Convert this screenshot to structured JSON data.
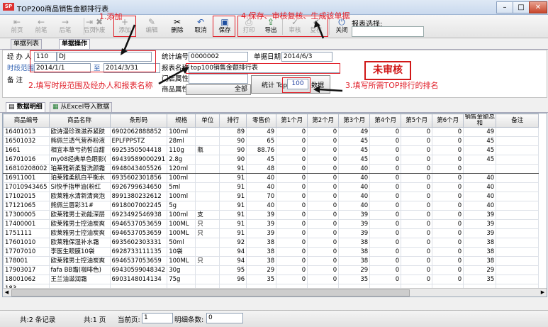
{
  "window": {
    "title": "TOP200商品销售金额排行表",
    "logo_text": "SP"
  },
  "toolbar": {
    "buttons": [
      {
        "label": "前页",
        "icon": "⇤"
      },
      {
        "label": "前笔",
        "icon": "←"
      },
      {
        "label": "后笔",
        "icon": "→"
      },
      {
        "label": "后页",
        "icon": "⇥"
      },
      {
        "label": "作废",
        "icon": "✖"
      },
      {
        "label": "添加",
        "icon": "+"
      },
      {
        "label": "编辑",
        "icon": "✎"
      },
      {
        "label": "删除",
        "icon": "✂"
      },
      {
        "label": "取消",
        "icon": "↶"
      },
      {
        "label": "保存",
        "icon": "▣"
      },
      {
        "label": "打印",
        "icon": "⎙"
      },
      {
        "label": "导出",
        "icon": "⇪"
      },
      {
        "label": "审核",
        "icon": "✓"
      },
      {
        "label": "复核",
        "icon": "✔"
      },
      {
        "label": "关闭",
        "icon": "⏻"
      }
    ],
    "report_select_label": "报表选择:"
  },
  "annotations": {
    "add": "1.添加",
    "save": "4.保存、审核复核、生成该单据",
    "range": "2.填写时段范围及经办人和报表名称",
    "top": "3.填写所需TOP排行的排名",
    "status_stamp": "未审核"
  },
  "tabs": [
    "单据列表",
    "单据操作"
  ],
  "form": {
    "handler_label": "经 办 人",
    "handler_code": "110",
    "handler_name": "DJ",
    "range_label": "时段范围",
    "range_start": "2014/1/1",
    "range_to": "至",
    "range_end": "2014/3/31",
    "memo_label": "备  注",
    "stat_no_label": "统计编号",
    "stat_no": "0000002",
    "doc_date_label": "单据日期",
    "doc_date": "2014/6/3",
    "report_name_label": "报表名称",
    "report_name": "top100销售金额排行表",
    "store_label": "门店属性",
    "attr_label": "商品属性",
    "all_button": "全部",
    "top_label": "统计 Top",
    "top_value": "100",
    "data_button": "数据"
  },
  "detail_tabs": [
    "数据明细",
    "从Excel导入数据"
  ],
  "grid": {
    "columns": [
      "商品编号",
      "商品名称",
      "条形码",
      "规格",
      "单位",
      "排行",
      "零售价",
      "第1个月",
      "第2个月",
      "第3个月",
      "第4个月",
      "第5个月",
      "第6个月",
      "销售金额总和",
      "备注"
    ],
    "rows": [
      [
        "16401013",
        "欧诗漫珍珠滋养紧肤",
        "6902062888852",
        "100ml",
        "",
        "89",
        "49",
        "0",
        "0",
        "49",
        "0",
        "0",
        "0",
        "49",
        ""
      ],
      [
        "16501032",
        "熊佩兰透气营养粉液",
        "EPLFPPSTZ",
        "28ml",
        "",
        "90",
        "65",
        "0",
        "0",
        "45",
        "0",
        "0",
        "0",
        "45",
        ""
      ],
      [
        "1661",
        "相宜本草亏药皙白甜",
        "6925350504418",
        "110g",
        "瓶",
        "90",
        "88.76",
        "0",
        "0",
        "45",
        "0",
        "0",
        "0",
        "45",
        ""
      ],
      [
        "16701016",
        "my08经典单色眼影(",
        "69439589000291",
        "2.8g",
        "",
        "90",
        "45",
        "0",
        "0",
        "45",
        "0",
        "0",
        "0",
        "45",
        ""
      ],
      [
        "16810208002",
        "珀莱雅新柔皙洗颜霜",
        "6948043405526",
        "120ml",
        "",
        "91",
        "48",
        "0",
        "0",
        "40",
        "0",
        "0",
        "0",
        "",
        ""
      ],
      [
        "16911001",
        "珀莱雅柔肌白平衡水",
        "6935602301856",
        "100ml",
        "",
        "91",
        "40",
        "0",
        "0",
        "40",
        "0",
        "0",
        "0",
        "40",
        ""
      ],
      [
        "17010943465",
        "SI快手指甲油(粉红",
        "6926799634650",
        "5ml",
        "",
        "91",
        "40",
        "0",
        "0",
        "40",
        "0",
        "0",
        "0",
        "40",
        ""
      ],
      [
        "17102015",
        "欧莱雅水清新清爽泡",
        "8991380232612",
        "100ml",
        "",
        "91",
        "70",
        "0",
        "0",
        "40",
        "0",
        "0",
        "0",
        "40",
        ""
      ],
      [
        "17121065",
        "熊佩兰唇彩31#",
        "6918007002245",
        "5g",
        "",
        "91",
        "40",
        "0",
        "0",
        "40",
        "0",
        "0",
        "0",
        "40",
        ""
      ],
      [
        "17300005",
        "欧莱雅男士劲能深层",
        "6923492546938",
        "100ml",
        "支",
        "91",
        "39",
        "0",
        "0",
        "39",
        "0",
        "0",
        "0",
        "39",
        ""
      ],
      [
        "17400001",
        "欧莱雅男士控油炭爽",
        "6946537053659",
        "100ML",
        "只",
        "91",
        "39",
        "0",
        "0",
        "39",
        "0",
        "0",
        "0",
        "39",
        ""
      ],
      [
        "1751111",
        "欧莱雅男士控油炭爽",
        "6946537053659",
        "100ML",
        "只",
        "91",
        "39",
        "0",
        "0",
        "39",
        "0",
        "0",
        "0",
        "39",
        ""
      ],
      [
        "17601010",
        "欧莱雅保湿补水霜",
        "6935602303331",
        "50ml",
        "",
        "92",
        "38",
        "0",
        "0",
        "38",
        "0",
        "0",
        "0",
        "38",
        ""
      ],
      [
        "17707010",
        "李医生眼膜10袋",
        "6928733111135",
        "10袋",
        "",
        "94",
        "38",
        "0",
        "0",
        "38",
        "0",
        "0",
        "0",
        "38",
        ""
      ],
      [
        "178001",
        "欧莱雅男士控油炭爽",
        "6946537053659",
        "100ML",
        "只",
        "94",
        "38",
        "0",
        "0",
        "38",
        "0",
        "0",
        "0",
        "38",
        ""
      ],
      [
        "17903017",
        "fafa BB霜(咖啡色)",
        "69430599048342",
        "30g",
        "",
        "95",
        "29",
        "0",
        "0",
        "29",
        "0",
        "0",
        "0",
        "29",
        ""
      ],
      [
        "18001062",
        "王兰油滋润霜",
        "6903148014134",
        "75g",
        "",
        "96",
        "35",
        "0",
        "0",
        "35",
        "0",
        "0",
        "0",
        "35",
        ""
      ],
      [
        "183",
        "",
        "",
        "",
        "",
        "",
        "",
        "",
        "",
        "",
        "",
        "",
        "",
        "",
        ""
      ]
    ]
  },
  "status": {
    "total_records": "共:2 条记录",
    "total_pages": "共:1 页",
    "current_page_label": "当前页:",
    "current_page": "1",
    "detail_count_label": "明细条数:",
    "detail_count": "0"
  }
}
